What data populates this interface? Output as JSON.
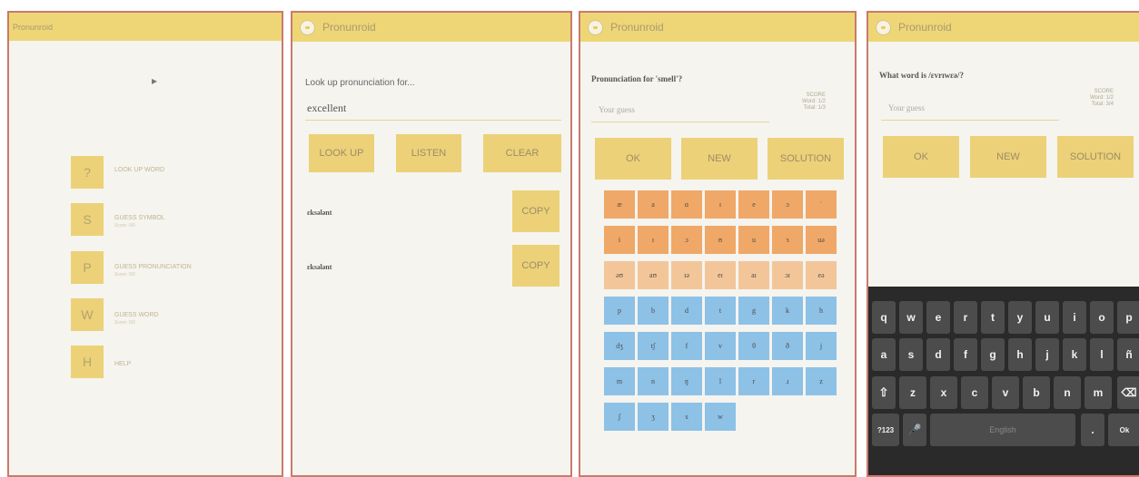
{
  "app_title": "Pronunroid",
  "home": {
    "menu": [
      {
        "key": "?",
        "label": "LOOK UP WORD",
        "sub": ""
      },
      {
        "key": "S",
        "label": "GUESS SYMBOL",
        "sub": "Score: 0/0"
      },
      {
        "key": "P",
        "label": "GUESS PRONUNCIATION",
        "sub": "Score: 0/0"
      },
      {
        "key": "W",
        "label": "GUESS WORD",
        "sub": "Score: 0/0"
      },
      {
        "key": "H",
        "label": "HELP",
        "sub": ""
      }
    ]
  },
  "lookup": {
    "prompt": "Look up pronunciation for...",
    "input_value": "excellent",
    "look_up_label": "LOOK UP",
    "listen_label": "LISTEN",
    "clear_label": "CLEAR",
    "results": [
      {
        "ipa": "ɛksələnt",
        "copy_label": "COPY"
      },
      {
        "ipa": "ɛksələnt",
        "copy_label": "COPY"
      }
    ]
  },
  "guess_symbol": {
    "question": "Pronunciation for 'smell'?",
    "placeholder": "Your guess",
    "score_lines": [
      "SCORE",
      "Word: 1/2",
      "Total: 1/3"
    ],
    "ok_label": "OK",
    "new_label": "NEW",
    "solution_label": "SOLUTION",
    "keys": [
      [
        "æ",
        "a",
        "ɑ",
        "ɪ",
        "e",
        "ɔ",
        "ˈ"
      ],
      [
        "i",
        "ɪ",
        "ɔ",
        "ʊ",
        "u",
        "ɜ",
        "uə"
      ],
      [
        "əʊ",
        "aʊ",
        "ɪə",
        "eɪ",
        "aɪ",
        "ɔɪ",
        "eə"
      ],
      [
        "p",
        "b",
        "d",
        "t",
        "g",
        "k",
        "h"
      ],
      [
        "dʒ",
        "tʃ",
        "f",
        "v",
        "θ",
        "ð",
        "j"
      ],
      [
        "m",
        "n",
        "ŋ",
        "l",
        "r",
        "ɹ",
        "z"
      ],
      [
        "ʃ",
        "ʒ",
        "s",
        "w"
      ]
    ],
    "colors": {
      "vowel": "#efa867",
      "diphthong": "#f3c699",
      "consonant": "#8dc1e6"
    }
  },
  "guess_word": {
    "question": "What word is /ɛvrɪwɛə/?",
    "placeholder": "Your guess",
    "score_lines": [
      "SCORE",
      "Word: 1/2",
      "Total: 3/4"
    ],
    "ok_label": "OK",
    "new_label": "NEW",
    "solution_label": "SOLUTION",
    "keyboard": {
      "row1": [
        "q",
        "w",
        "e",
        "r",
        "t",
        "y",
        "u",
        "i",
        "o",
        "p"
      ],
      "row2": [
        "a",
        "s",
        "d",
        "f",
        "g",
        "h",
        "j",
        "k",
        "l",
        "ñ"
      ],
      "row3": [
        "z",
        "x",
        "c",
        "v",
        "b",
        "n",
        "m"
      ],
      "sym_label": "?123",
      "space_label": "English",
      "period_label": ".",
      "enter_label": "Ok"
    }
  }
}
